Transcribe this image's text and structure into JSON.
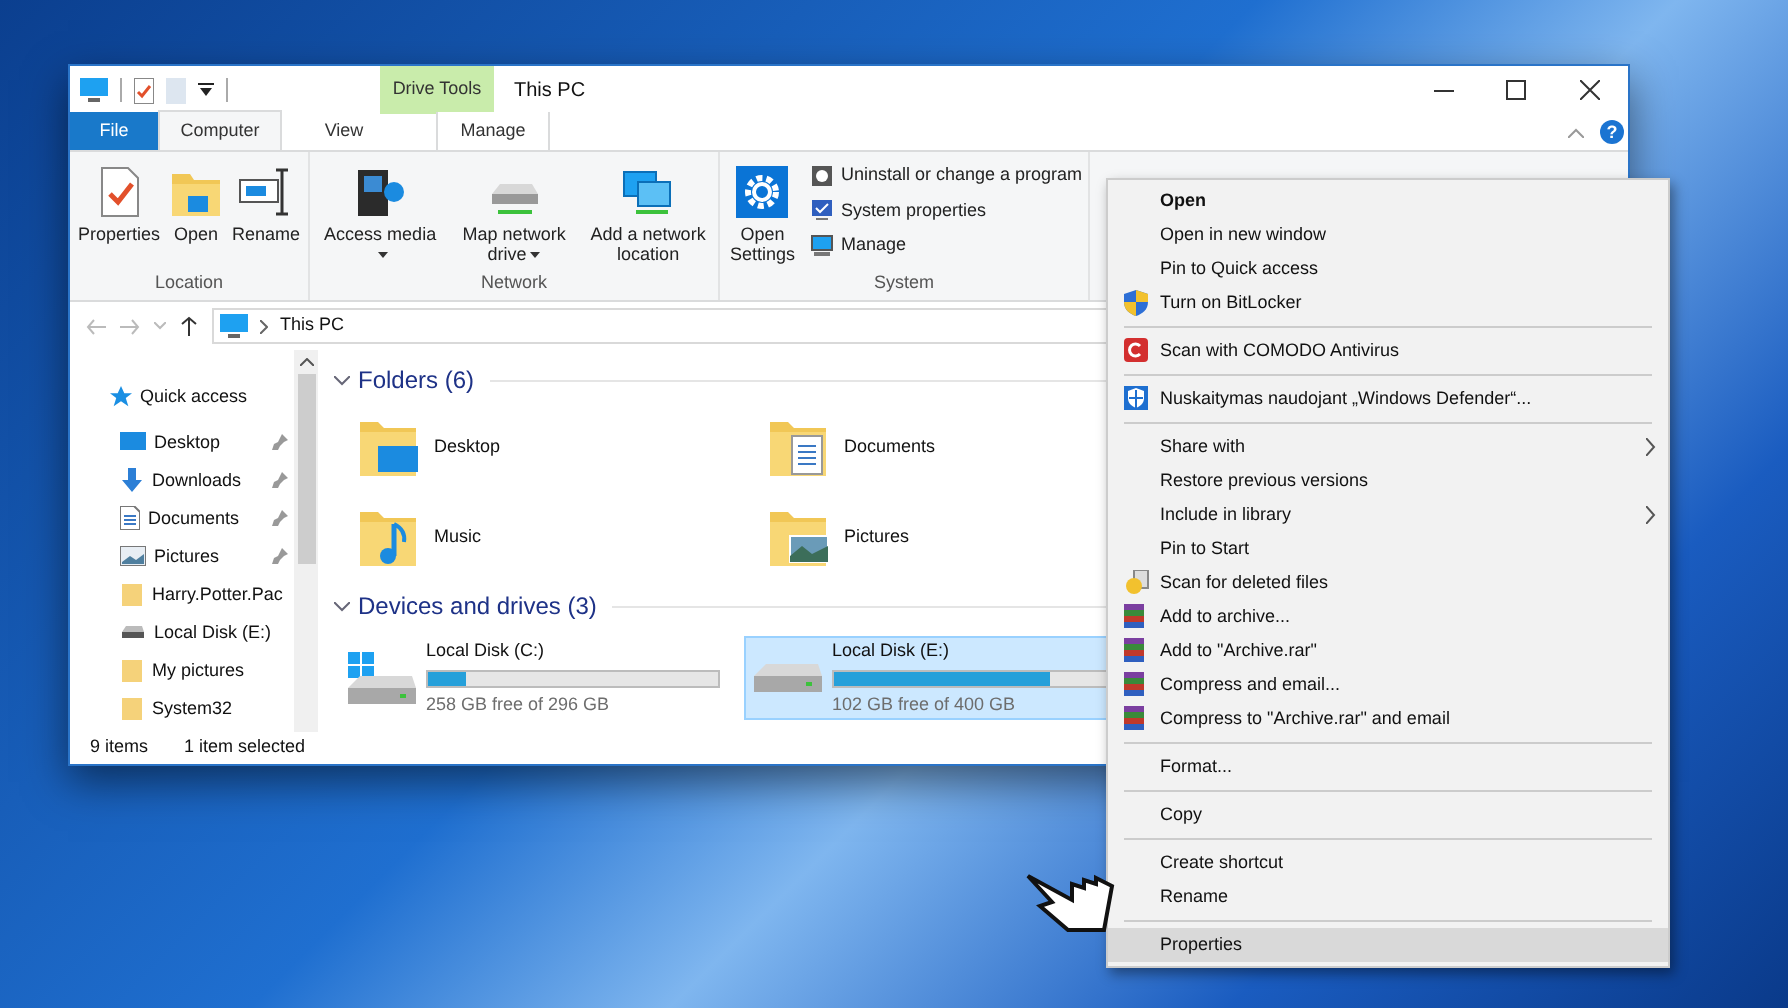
{
  "window": {
    "title": "This PC",
    "contextual_tab": "Drive Tools",
    "help": "?"
  },
  "tabs": [
    {
      "label": "File",
      "kind": "file",
      "selected": false
    },
    {
      "label": "Computer",
      "kind": "tab",
      "selected": true
    },
    {
      "label": "View",
      "kind": "tab",
      "selected": false
    },
    {
      "label": "Manage",
      "kind": "contextual",
      "selected": false
    }
  ],
  "ribbon": [
    {
      "name": "Location",
      "buttons": [
        {
          "label": "Properties",
          "has_menu": false
        },
        {
          "label": "Open",
          "has_menu": false
        },
        {
          "label": "Rename",
          "has_menu": false
        }
      ]
    },
    {
      "name": "Network",
      "buttons": [
        {
          "label": "Access media",
          "has_menu": true
        },
        {
          "label": "Map network drive",
          "has_menu": true
        },
        {
          "label": "Add a network location",
          "has_menu": false
        }
      ]
    },
    {
      "name": "System",
      "buttons": [
        {
          "label": "Open Settings",
          "has_menu": false
        }
      ],
      "small_buttons": [
        "Uninstall or change a program",
        "System properties",
        "Manage"
      ]
    }
  ],
  "address": {
    "path": "This PC"
  },
  "nav_pane": [
    {
      "label": "Quick access",
      "pinned": false
    },
    {
      "label": "Desktop",
      "pinned": true
    },
    {
      "label": "Downloads",
      "pinned": true
    },
    {
      "label": "Documents",
      "pinned": true
    },
    {
      "label": "Pictures",
      "pinned": true
    },
    {
      "label": "Harry.Potter.Pac",
      "pinned": false
    },
    {
      "label": "Local Disk (E:)",
      "pinned": false
    },
    {
      "label": "My pictures",
      "pinned": false
    },
    {
      "label": "System32",
      "pinned": false
    }
  ],
  "folders": {
    "heading": "Folders (6)",
    "items": [
      "Desktop",
      "Documents",
      "Music",
      "Pictures"
    ]
  },
  "drives": {
    "heading": "Devices and drives (3)",
    "items": [
      {
        "name": "Local Disk (C:)",
        "free": "258 GB free of 296 GB",
        "level": 0.13,
        "selected": false
      },
      {
        "name": "Local Disk (E:)",
        "free": "102 GB free of 400 GB",
        "level": 0.745,
        "selected": true
      }
    ]
  },
  "status_bar": {
    "items": "9 items",
    "selection": "1 item selected"
  },
  "context_menu": [
    {
      "kind": "item",
      "label": "Open",
      "default": true,
      "submenu": false
    },
    {
      "kind": "item",
      "label": "Open in new window",
      "default": false,
      "submenu": false
    },
    {
      "kind": "item",
      "label": "Pin to Quick access",
      "default": false,
      "submenu": false
    },
    {
      "kind": "item",
      "label": "Turn on BitLocker",
      "default": false,
      "submenu": false
    },
    {
      "kind": "separator"
    },
    {
      "kind": "item",
      "label": "Scan with COMODO Antivirus",
      "default": false,
      "submenu": false
    },
    {
      "kind": "separator"
    },
    {
      "kind": "item",
      "label": "Nuskaitymas naudojant „Windows Defender“...",
      "default": false,
      "submenu": false
    },
    {
      "kind": "separator"
    },
    {
      "kind": "item",
      "label": "Share with",
      "default": false,
      "submenu": true
    },
    {
      "kind": "item",
      "label": "Restore previous versions",
      "default": false,
      "submenu": false
    },
    {
      "kind": "item",
      "label": "Include in library",
      "default": false,
      "submenu": true
    },
    {
      "kind": "item",
      "label": "Pin to Start",
      "default": false,
      "submenu": false
    },
    {
      "kind": "item",
      "label": "Scan for deleted files",
      "default": false,
      "submenu": false
    },
    {
      "kind": "item",
      "label": "Add to archive...",
      "default": false,
      "submenu": false
    },
    {
      "kind": "item",
      "label": "Add to \"Archive.rar\"",
      "default": false,
      "submenu": false
    },
    {
      "kind": "item",
      "label": "Compress and email...",
      "default": false,
      "submenu": false
    },
    {
      "kind": "item",
      "label": "Compress to \"Archive.rar\" and email",
      "default": false,
      "submenu": false
    },
    {
      "kind": "separator"
    },
    {
      "kind": "item",
      "label": "Format...",
      "default": false,
      "submenu": false
    },
    {
      "kind": "separator"
    },
    {
      "kind": "item",
      "label": "Copy",
      "default": false,
      "submenu": false
    },
    {
      "kind": "separator"
    },
    {
      "kind": "item",
      "label": "Create shortcut",
      "default": false,
      "submenu": false
    },
    {
      "kind": "item",
      "label": "Rename",
      "default": false,
      "submenu": false
    },
    {
      "kind": "separator"
    },
    {
      "kind": "item",
      "label": "Properties",
      "default": false,
      "submenu": false,
      "selected": true
    }
  ]
}
